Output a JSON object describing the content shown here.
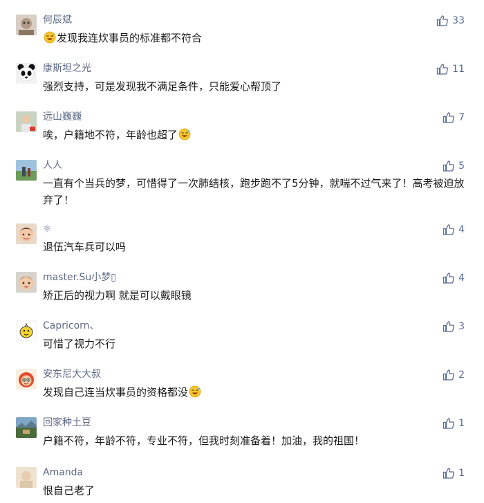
{
  "colors": {
    "username": "#5e6b85",
    "text": "#1a1a1a",
    "like": "#576b95"
  },
  "comments": [
    {
      "username": "何辰斌",
      "text_before": "",
      "text_after": "发现我连炊事员的标准都不符合",
      "emoji": "sweat-smile-icon",
      "likes": "33",
      "avatar": "cat-avatar"
    },
    {
      "username": "康斯坦之光",
      "text": "强烈支持，可是发现我不满足条件，只能爱心帮顶了",
      "likes": "11",
      "avatar": "panda-avatar"
    },
    {
      "username": "远山巍巍",
      "text_before": "唉，户籍地不符，年龄也超了",
      "text_after": "",
      "emoji": "sweat-smile-icon",
      "likes": "7",
      "avatar": "portrait-avatar"
    },
    {
      "username": "人人",
      "text": "一直有个当兵的梦，可惜得了一次肺结核，跑步跑不了5分钟，就喘不过气来了！高考被迫放弃了！",
      "likes": "5",
      "avatar": "landscape-avatar"
    },
    {
      "username": "⚛",
      "text": "退伍汽车兵可以吗",
      "likes": "4",
      "avatar": "child-avatar"
    },
    {
      "username": "master.Su小梦▯",
      "text": "矫正后的视力啊 就是可以戴眼镜",
      "likes": "4",
      "avatar": "child-avatar-2"
    },
    {
      "username": "Capricorn、",
      "text": "可惜了视力不行",
      "likes": "3",
      "avatar": "cartoon-avatar"
    },
    {
      "username": "安东尼大大叔",
      "text_before": "发现自己连当炊事员的资格都没",
      "text_after": "",
      "emoji": "sweat-smile-icon",
      "likes": "2",
      "avatar": "cartoon-red-avatar"
    },
    {
      "username": "回家种土豆",
      "text": "户籍不符，年龄不符，专业不符，但我时刻准备着！加油，我的祖国！",
      "likes": "1",
      "avatar": "scenery-avatar"
    },
    {
      "username": "Amanda",
      "text": "恨自己老了",
      "likes": "1",
      "avatar": "beige-avatar"
    }
  ]
}
